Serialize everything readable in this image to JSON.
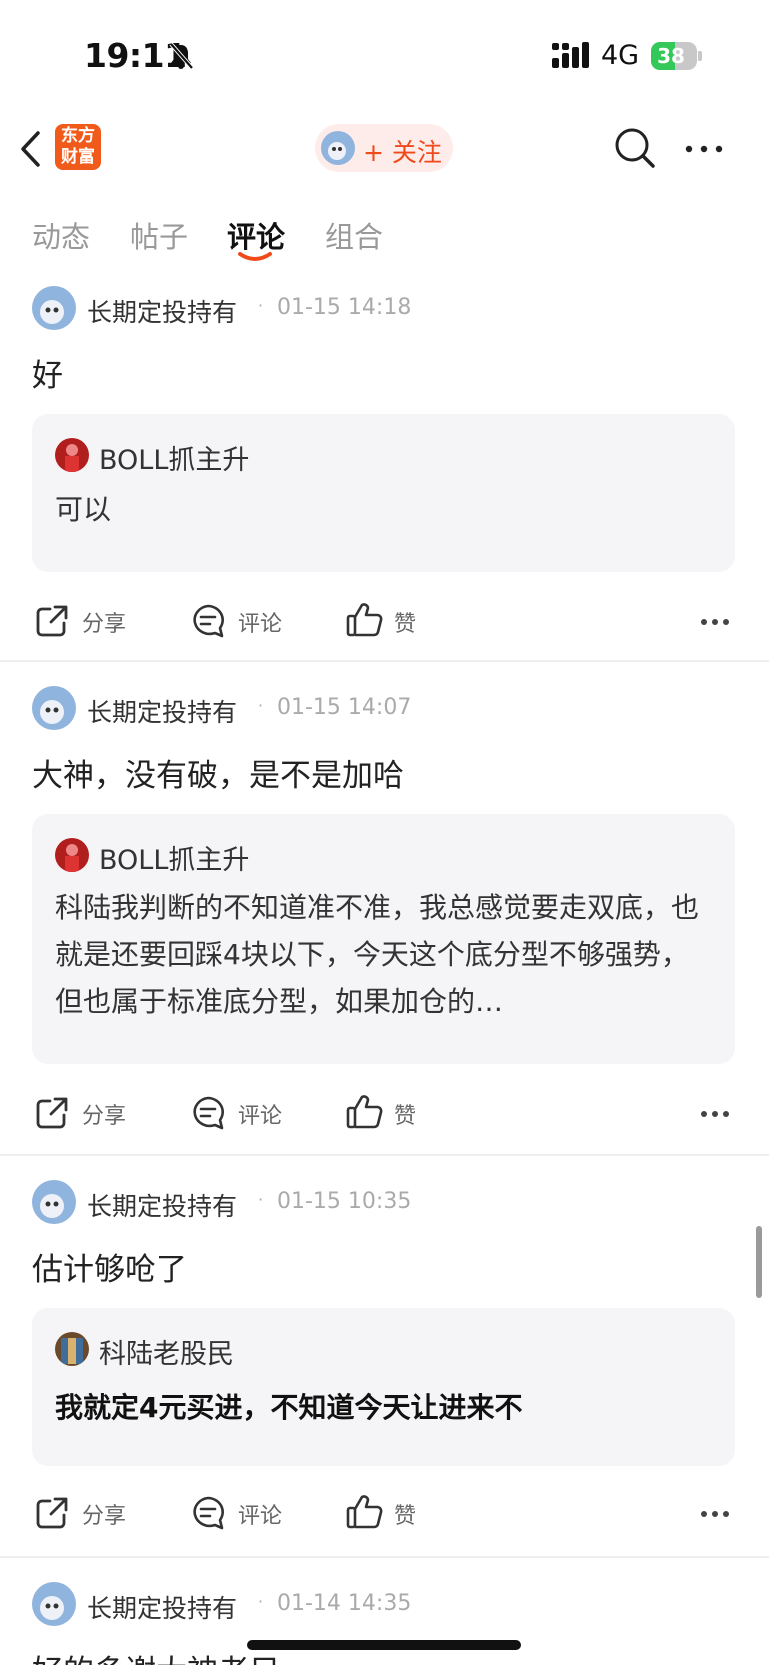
{
  "status_bar": {
    "time": "19:11",
    "network": "4G",
    "battery": "38"
  },
  "nav": {
    "logo_text": "东方\n财富",
    "follow_label": "+ 关注"
  },
  "tabs": [
    {
      "label": "动态",
      "active": false
    },
    {
      "label": "帖子",
      "active": false
    },
    {
      "label": "评论",
      "active": true
    },
    {
      "label": "组合",
      "active": false
    }
  ],
  "posts": [
    {
      "user": "长期定投持有",
      "time": "01-15 14:18",
      "content": "好",
      "quote": {
        "user": "BOLL抓主升",
        "text": "可以",
        "bold": false
      },
      "actions": {
        "share": "分享",
        "comment": "评论",
        "like": "赞"
      }
    },
    {
      "user": "长期定投持有",
      "time": "01-15 14:07",
      "content": "大神，没有破，是不是加哈",
      "quote": {
        "user": "BOLL抓主升",
        "text": "科陆我判断的不知道准不准，我总感觉要走双底，也就是还要回踩4块以下，今天这个底分型不够强势，但也属于标准底分型，如果加仓的…",
        "bold": false
      },
      "actions": {
        "share": "分享",
        "comment": "评论",
        "like": "赞"
      }
    },
    {
      "user": "长期定投持有",
      "time": "01-15 10:35",
      "content": "估计够呛了",
      "quote": {
        "user": "科陆老股民",
        "text": "我就定4元买进，不知道今天让进来不",
        "bold": true
      },
      "actions": {
        "share": "分享",
        "comment": "评论",
        "like": "赞"
      }
    },
    {
      "user": "长期定投持有",
      "time": "01-14 14:35",
      "content": "好的多谢大神老只"
    }
  ],
  "colors": {
    "accent": "#f04a1a",
    "logo_bg": "#f05a1a",
    "quote_bg": "#f5f5f7",
    "battery_green": "#34c759"
  }
}
